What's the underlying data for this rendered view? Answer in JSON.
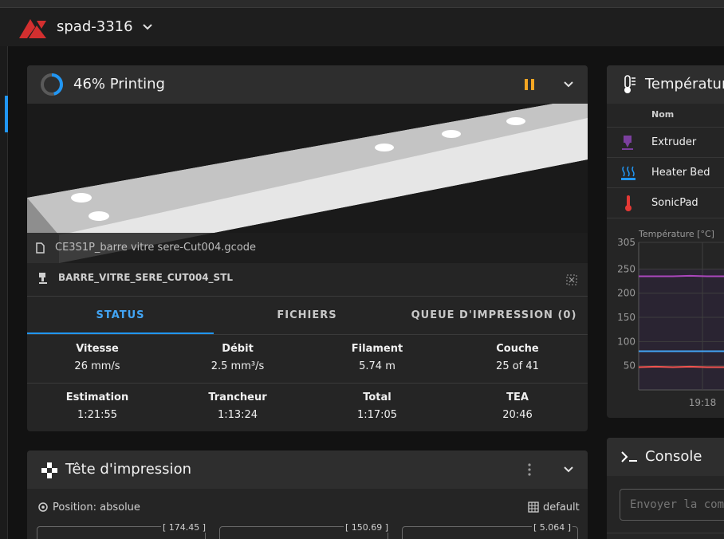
{
  "appbar": {
    "printer_name": "spad-3316"
  },
  "status_card": {
    "progress_percent": 46,
    "title": "46% Printing",
    "filename": "CE3S1P_barre vitre sere-Cut004.gcode",
    "object_name": "BARRE_VITRE_SERE_CUT004_STL",
    "tabs": [
      "STATUS",
      "FICHIERS",
      "QUEUE D'IMPRESSION (0)"
    ],
    "active_tab": "STATUS",
    "stats_row1": [
      {
        "label": "Vitesse",
        "value": "26 mm/s"
      },
      {
        "label": "Débit",
        "value": "2.5 mm³/s"
      },
      {
        "label": "Filament",
        "value": "5.74 m"
      },
      {
        "label": "Couche",
        "value": "25 of 41"
      }
    ],
    "stats_row2": [
      {
        "label": "Estimation",
        "value": "1:21:55"
      },
      {
        "label": "Trancheur",
        "value": "1:13:24"
      },
      {
        "label": "Total",
        "value": "1:17:05"
      },
      {
        "label": "TEA",
        "value": "20:46"
      }
    ]
  },
  "toolhead_card": {
    "title": "Tête d'impression",
    "position_label": "Position: absolue",
    "profile_label": "default",
    "axes": [
      {
        "max": "[ 174.45 ]"
      },
      {
        "max": "[ 150.69 ]"
      },
      {
        "max": "[ 5.064 ]"
      }
    ]
  },
  "temperature_card": {
    "title": "Températures",
    "column_name": "Nom",
    "sensors": [
      {
        "name": "Extruder",
        "icon": "extruder-icon",
        "color": "#7b3f9e"
      },
      {
        "name": "Heater Bed",
        "icon": "heater-bed-icon",
        "color": "#2196f3"
      },
      {
        "name": "SonicPad",
        "icon": "thermometer-icon",
        "color": "#e53935"
      }
    ],
    "chart_label": "Température [°C]"
  },
  "chart_data": {
    "type": "line",
    "title": "",
    "ylabel": "Température [°C]",
    "ylim": [
      0,
      305
    ],
    "yticks": [
      305,
      250,
      200,
      150,
      100,
      50
    ],
    "xticks": [
      "19:18"
    ],
    "series": [
      {
        "name": "Extruder",
        "color": "#ab47bc",
        "values": [
          235,
          235,
          235,
          236,
          235,
          235
        ]
      },
      {
        "name": "Heater Bed",
        "color": "#42a5f5",
        "values": [
          80,
          80,
          80,
          80,
          80,
          80
        ]
      },
      {
        "name": "SonicPad",
        "color": "#ef5350",
        "values": [
          47,
          48,
          47,
          48,
          47,
          47
        ]
      }
    ]
  },
  "console_card": {
    "title": "Console",
    "input_placeholder": "Envoyer la commande"
  },
  "colors": {
    "accent": "#2196f3",
    "pause": "#f5a623",
    "logo": "#d32f2f"
  }
}
